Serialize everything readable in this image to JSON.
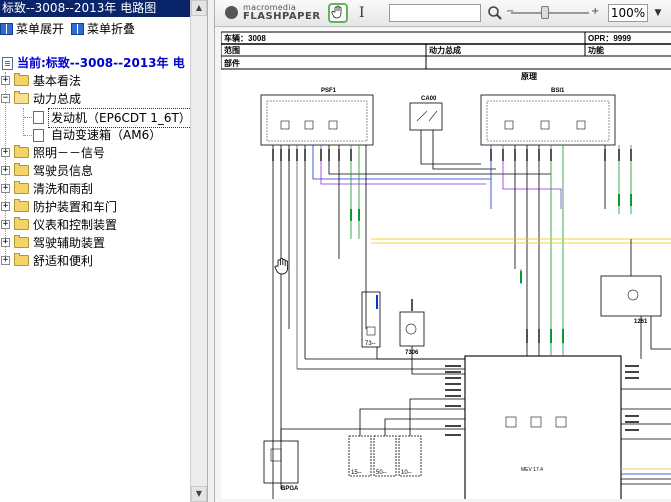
{
  "window": {
    "title": "标致--3008--2013年 电路图"
  },
  "menu": {
    "expand_label": "菜单展开",
    "collapse_label": "菜单折叠"
  },
  "current": "当前:标致--3008--2013年 电",
  "tree": [
    {
      "label": "基本看法",
      "expanded": false
    },
    {
      "label": "动力总成",
      "expanded": true,
      "children": [
        {
          "label": "发动机（EP6CDT 1_6T）",
          "selected": true
        },
        {
          "label": "自动变速箱（AM6）",
          "selected": false
        }
      ]
    },
    {
      "label": "照明－－信号",
      "expanded": false
    },
    {
      "label": "驾驶员信息",
      "expanded": false
    },
    {
      "label": "清洗和雨刮",
      "expanded": false
    },
    {
      "label": "防护装置和车门",
      "expanded": false
    },
    {
      "label": "仪表和控制装置",
      "expanded": false
    },
    {
      "label": "驾驶辅助装置",
      "expanded": false
    },
    {
      "label": "舒适和便利",
      "expanded": false
    }
  ],
  "viewer": {
    "logo_top": "macromedia",
    "logo_bottom": "FLASHPAPER",
    "zoom": "100%",
    "zoom_dropdown": "▼",
    "icons": {
      "hand": "hand-icon",
      "text_select": "text-cursor-icon",
      "search": "search-icon"
    }
  },
  "doc": {
    "vehicle_label": "车辆：3008",
    "opr_label": "OPR：9999",
    "scope_label": "范围",
    "scope_value": "动力总成",
    "function_label": "功能",
    "part_label": "部件",
    "section_title": "原理",
    "components": {
      "psf1": "PSF1",
      "ca00": "CA00",
      "bsi1": "BSI1",
      "c7306": "7306",
      "c1261": "1261",
      "bpga": "BPGA",
      "mev": "MEV 17.4",
      "c73": "73--",
      "c15": "15--",
      "c50": "50--",
      "c10": "10--"
    }
  },
  "colors": {
    "titlebar": "#0a246a",
    "current_text": "#0000cc",
    "hand_border": "#5cb85c",
    "wire_blue": "#1a2fd0",
    "wire_purple": "#8a2be2",
    "wire_green": "#0b9a2c",
    "wire_yellow": "#e6c800"
  }
}
